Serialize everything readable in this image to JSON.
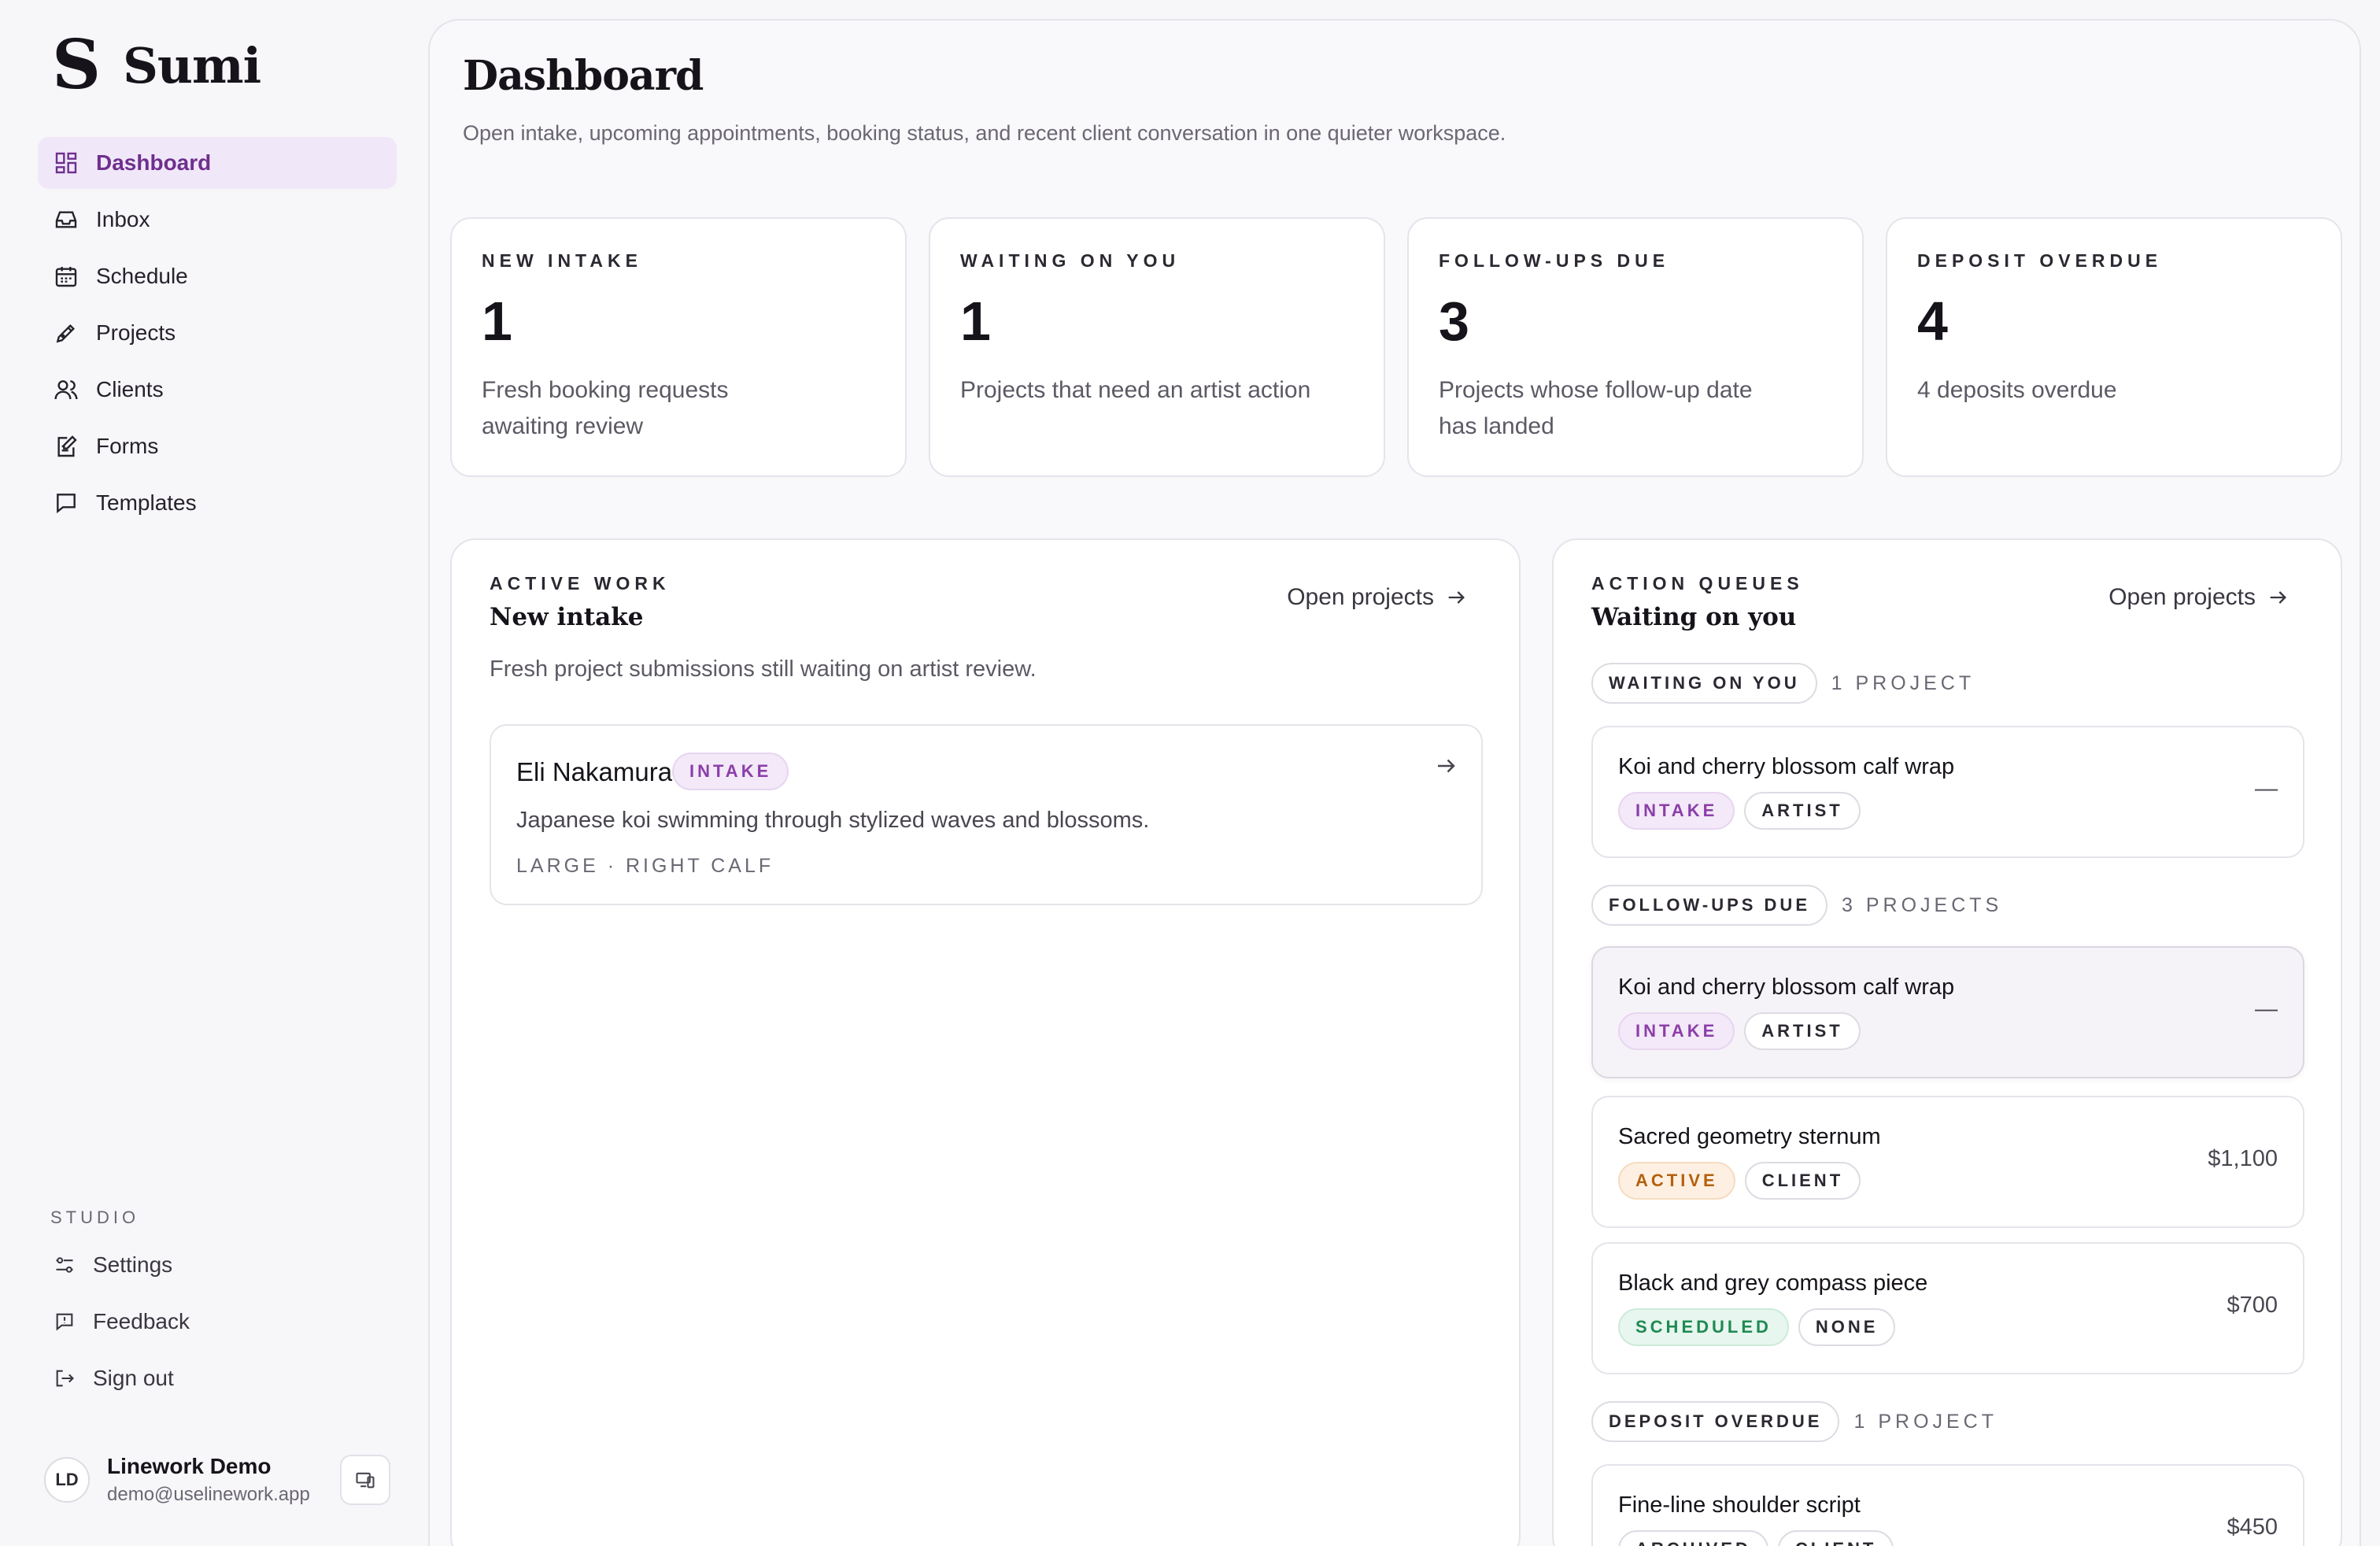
{
  "brand": {
    "name": "Sumi",
    "mark": "S"
  },
  "nav": [
    {
      "label": "Dashboard",
      "icon": "dashboard-icon",
      "active": true
    },
    {
      "label": "Inbox",
      "icon": "inbox-icon"
    },
    {
      "label": "Schedule",
      "icon": "calendar-icon"
    },
    {
      "label": "Projects",
      "icon": "pen-icon"
    },
    {
      "label": "Clients",
      "icon": "users-icon"
    },
    {
      "label": "Forms",
      "icon": "form-icon"
    },
    {
      "label": "Templates",
      "icon": "message-icon"
    }
  ],
  "studio": {
    "label": "STUDIO",
    "items": [
      {
        "label": "Settings",
        "icon": "sliders-icon"
      },
      {
        "label": "Feedback",
        "icon": "feedback-icon"
      },
      {
        "label": "Sign out",
        "icon": "sign-out-icon"
      }
    ]
  },
  "user": {
    "initials": "LD",
    "name": "Linework Demo",
    "email": "demo@uselinework.app"
  },
  "page": {
    "title": "Dashboard",
    "subtitle": "Open intake, upcoming appointments, booking status, and recent client conversation in one quieter workspace."
  },
  "stats": [
    {
      "label": "NEW INTAKE",
      "value": "1",
      "desc": "Fresh booking requests awaiting review"
    },
    {
      "label": "WAITING ON YOU",
      "value": "1",
      "desc": "Projects that need an artist action"
    },
    {
      "label": "FOLLOW-UPS DUE",
      "value": "3",
      "desc": "Projects whose follow-up date has landed"
    },
    {
      "label": "DEPOSIT OVERDUE",
      "value": "4",
      "desc": "4 deposits overdue"
    }
  ],
  "active_work": {
    "eyebrow": "ACTIVE WORK",
    "title": "New intake",
    "link": "Open projects",
    "desc": "Fresh project submissions still waiting on artist review.",
    "card": {
      "name": "Eli Nakamura",
      "tag": "INTAKE",
      "desc": "Japanese koi swimming through stylized waves and blossoms.",
      "meta": "LARGE · RIGHT CALF"
    }
  },
  "action_queues": {
    "eyebrow": "ACTION QUEUES",
    "title": "Waiting on you",
    "link": "Open projects",
    "groups": [
      {
        "label": "WAITING ON YOU",
        "count": "1 PROJECT",
        "items": [
          {
            "title": "Koi and cherry blossom calf wrap",
            "tags": [
              {
                "text": "INTAKE",
                "kind": "intake"
              },
              {
                "text": "ARTIST",
                "kind": "plain"
              }
            ],
            "right": "—"
          }
        ]
      },
      {
        "label": "FOLLOW-UPS DUE",
        "count": "3 PROJECTS",
        "items": [
          {
            "title": "Koi and cherry blossom calf wrap",
            "tags": [
              {
                "text": "INTAKE",
                "kind": "intake"
              },
              {
                "text": "ARTIST",
                "kind": "plain"
              }
            ],
            "right": "—",
            "highlight": true
          },
          {
            "title": "Sacred geometry sternum",
            "tags": [
              {
                "text": "ACTIVE",
                "kind": "active"
              },
              {
                "text": "CLIENT",
                "kind": "plain"
              }
            ],
            "right": "$1,100"
          },
          {
            "title": "Black and grey compass piece",
            "tags": [
              {
                "text": "SCHEDULED",
                "kind": "scheduled"
              },
              {
                "text": "NONE",
                "kind": "plain"
              }
            ],
            "right": "$700"
          }
        ]
      },
      {
        "label": "DEPOSIT OVERDUE",
        "count": "1 PROJECT",
        "items": [
          {
            "title": "Fine-line shoulder script",
            "tags": [
              {
                "text": "ARCHIVED",
                "kind": "plain"
              },
              {
                "text": "CLIENT",
                "kind": "plain"
              }
            ],
            "right": "$450"
          }
        ]
      }
    ]
  }
}
